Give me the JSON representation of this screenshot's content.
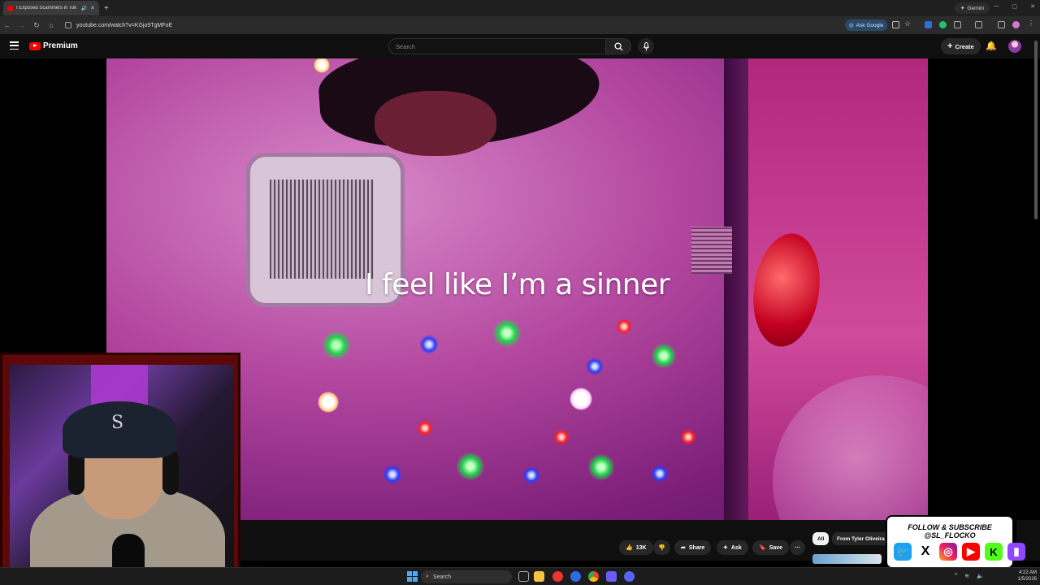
{
  "browser": {
    "tab_title": "I Exposed Scammers in Tok",
    "new_tab": "+",
    "gemini_label": "Gemini",
    "url": "youtube.com/watch?v=KGjo9TgMFoE",
    "ask_google": "Ask Google",
    "window_controls": [
      "—",
      "▢",
      "✕"
    ]
  },
  "youtube": {
    "logo_text": "Premium",
    "search_placeholder": "Search",
    "create_label": "Create"
  },
  "video": {
    "subtitle": "I feel like I’m a sinner"
  },
  "actions": {
    "like_count": "13K",
    "share_label": "Share",
    "ask_label": "Ask",
    "save_label": "Save",
    "more_label": "···"
  },
  "chips": {
    "all": "All",
    "from": "From Tyler Oliveira"
  },
  "overlay": {
    "follow_text": "FOLLOW & SUBSCRIBE @SL_FLOCKO",
    "icons": [
      "twitter-icon",
      "x-icon",
      "instagram-icon",
      "youtube-icon",
      "kick-icon",
      "twitch-icon"
    ]
  },
  "taskbar": {
    "search_label": "Search",
    "time": "4:22 AM",
    "date": "1/5/2026"
  },
  "colors": {
    "youtube_red": "#ff0000",
    "webcam_frame": "#5d0909",
    "video_magenta": "#b3479f"
  }
}
